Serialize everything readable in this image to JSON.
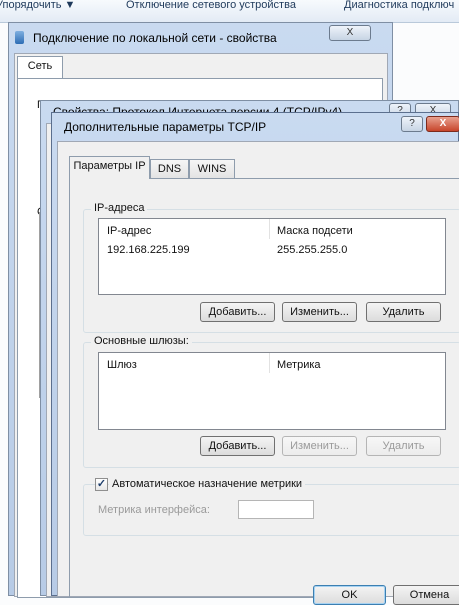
{
  "top_menu": {
    "item1": "Упорядочить ▼",
    "item2": "Отключение сетевого устройства",
    "item3": "Диагностика подключ"
  },
  "win1": {
    "title": "Подключение по локальной сети - свойства",
    "close": "X",
    "tab": "Сеть",
    "letter_p": "П",
    "letter_c": "С"
  },
  "win2": {
    "title": "Свойства: Протокол Интернета версии 4 (TCP/IPv4)",
    "help": "?",
    "close": "X"
  },
  "win3": {
    "title": "Дополнительные параметры TCP/IP",
    "help": "?",
    "close": "X",
    "tabs": [
      "Параметры IP",
      "DNS",
      "WINS"
    ],
    "ip_group": {
      "title": "IP-адреса",
      "col_ip": "IP-адрес",
      "col_mask": "Маска подсети",
      "ip_value": "192.168.225.199",
      "mask_value": "255.255.255.0",
      "add": "Добавить...",
      "edit": "Изменить...",
      "delete": "Удалить"
    },
    "gw_group": {
      "title": "Основные шлюзы:",
      "col_gateway": "Шлюз",
      "col_metric": "Метрика",
      "add": "Добавить...",
      "edit": "Изменить...",
      "delete": "Удалить"
    },
    "auto_metric": {
      "label": "Автоматическое назначение метрики",
      "checked": true
    },
    "interface_metric": {
      "label": "Метрика интерфейса:",
      "value": ""
    },
    "ok": "OK",
    "cancel": "Отмена"
  }
}
